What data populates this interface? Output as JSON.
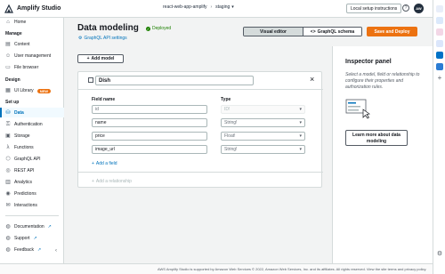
{
  "topbar": {
    "app_title": "Amplify Studio",
    "app": "react-web-app-amplify",
    "branch": "staging",
    "local_setup": "Local setup instructions",
    "avatar_initials": "AW"
  },
  "sidebar": {
    "home": "Home",
    "manage_header": "Manage",
    "manage": [
      "Content",
      "User management",
      "File browser"
    ],
    "design_header": "Design",
    "ui_library": "UI Library",
    "new_badge": "NEW",
    "setup_header": "Set up",
    "setup": [
      "Data",
      "Authentication",
      "Storage",
      "Functions",
      "GraphQL API",
      "REST API",
      "Analytics",
      "Predictions",
      "Interactions"
    ],
    "active": "Data",
    "bottom": [
      "Documentation",
      "Support",
      "Feedback"
    ]
  },
  "main": {
    "title": "Data modeling",
    "status": "Deployed",
    "gql_link": "GraphQL API settings",
    "tab_visual": "Visual editor",
    "tab_schema": "GraphQL schema",
    "deploy": "Save and Deploy",
    "add_model": "Add model"
  },
  "model": {
    "name": "Dish",
    "field_name_header": "Field name",
    "type_header": "Type",
    "fields": [
      {
        "name": "id",
        "type": "ID!",
        "locked": true
      },
      {
        "name": "name",
        "type": "String!"
      },
      {
        "name": "price",
        "type": "Float!"
      },
      {
        "name": "image_url",
        "type": "String!"
      }
    ],
    "add_field": "Add a field",
    "add_relationship": "Add a relationship"
  },
  "inspector": {
    "title": "Inspector panel",
    "description": "Select a model, field or relationship to configure their properties and authorization rules.",
    "learn_more": "Learn more about data modeling"
  },
  "footer": {
    "text": "AWS Amplify Studio is supported by Amazon Web Services © 2022, Amazon Web Services, Inc. and its affiliates. All rights reserved. View the site terms and privacy policy."
  },
  "colors": {
    "accent": "#0073bb",
    "deploy": "#ec7211",
    "success": "#1d8102"
  }
}
